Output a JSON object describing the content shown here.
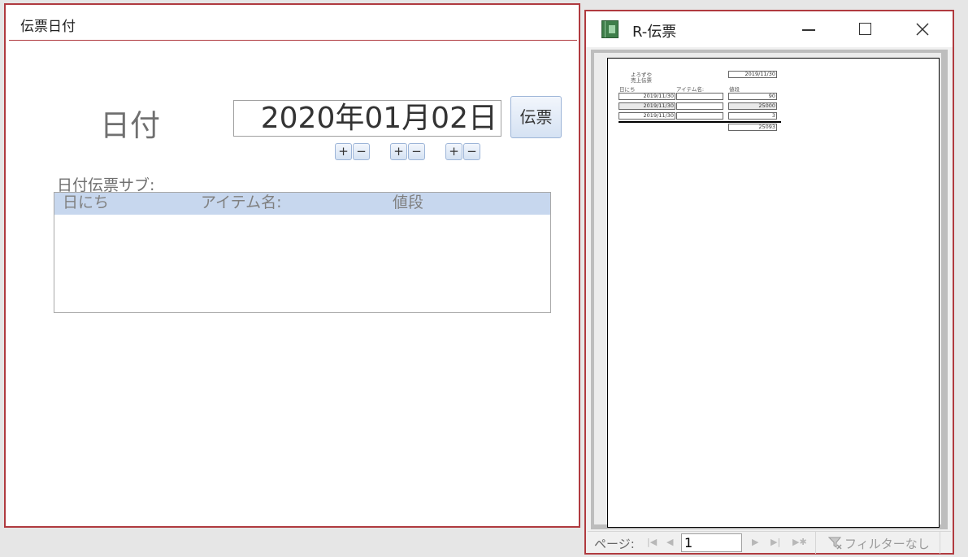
{
  "form": {
    "title": "伝票日付",
    "date_label": "日付",
    "date_value": "2020年01月02日",
    "slip_button": "伝票",
    "plus": "+",
    "minus": "−",
    "subform_label": "日付伝票サブ:",
    "subform_columns": [
      "日にち",
      "アイテム名:",
      "値段"
    ]
  },
  "report": {
    "title": "R-伝票",
    "page": {
      "shop_line1": "よろずや",
      "shop_line2": "売上伝票",
      "header_date": "2019/11/30",
      "col_date": "日にち",
      "col_item": "アイテム名:",
      "col_price": "値段",
      "rows": [
        {
          "date": "2019/11/30",
          "item": "",
          "price": "90"
        },
        {
          "date": "2019/11/30",
          "item": "",
          "price": "25000"
        },
        {
          "date": "2019/11/30",
          "item": "",
          "price": "3"
        }
      ],
      "total": "25093"
    },
    "nav": {
      "page_label": "ページ:",
      "page_value": "1",
      "filter_label": "フィルターなし"
    }
  },
  "colors": {
    "window_border": "#b03a3f",
    "subform_header": "#c7d7ee",
    "button_fill": "#d5e2f3"
  },
  "icons": [
    "minimize-icon",
    "maximize-icon",
    "close-icon",
    "first-page-icon",
    "prev-page-icon",
    "next-page-icon",
    "last-page-icon",
    "new-record-icon",
    "filter-icon",
    "report-app-icon"
  ]
}
